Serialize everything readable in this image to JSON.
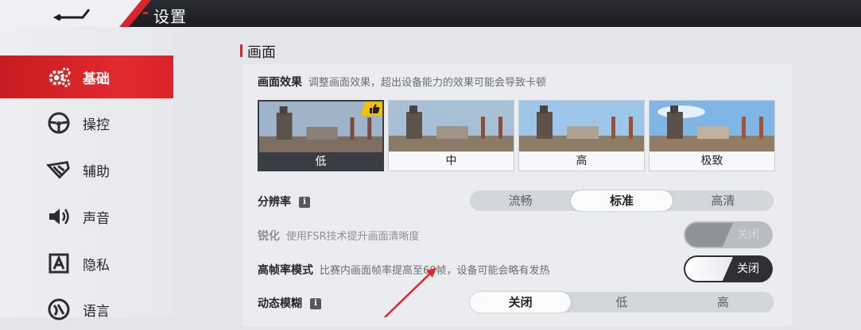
{
  "header": {
    "title": "设置",
    "back_icon": "back-arrow-icon"
  },
  "sidebar": {
    "items": [
      {
        "label": "基础",
        "icon": "gear-icon",
        "active": true
      },
      {
        "label": "操控",
        "icon": "steering-wheel-icon",
        "active": false
      },
      {
        "label": "辅助",
        "icon": "assist-icon",
        "active": false
      },
      {
        "label": "声音",
        "icon": "speaker-icon",
        "active": false
      },
      {
        "label": "隐私",
        "icon": "privacy-icon",
        "active": false
      },
      {
        "label": "语言",
        "icon": "language-icon",
        "active": false
      }
    ]
  },
  "section": {
    "title": "画面"
  },
  "graphics_quality": {
    "label": "画面效果",
    "desc": "调整画面效果，超出设备能力的效果可能会导致卡顿",
    "options": [
      "低",
      "中",
      "高",
      "极致"
    ],
    "selected": "低",
    "recommended_badge": "thumbs-up-icon"
  },
  "resolution": {
    "label": "分辨率",
    "info": "i",
    "options": [
      "流畅",
      "标准",
      "高清"
    ],
    "selected": "标准"
  },
  "sharpen": {
    "label": "锐化",
    "desc": "使用FSR技术提升画面清晰度",
    "state": "关闭",
    "enabled": false
  },
  "high_fps": {
    "label": "高帧率模式",
    "desc": "比赛内画面帧率提高至60帧，设备可能会略有发热",
    "state": "关闭"
  },
  "motion_blur": {
    "label": "动态模糊",
    "info": "i",
    "options": [
      "关闭",
      "低",
      "高"
    ],
    "selected": "关闭"
  },
  "colors": {
    "accent_red": "#d9252a",
    "badge_yellow": "#f2c200",
    "toggle_dark": "#2d2f35"
  }
}
